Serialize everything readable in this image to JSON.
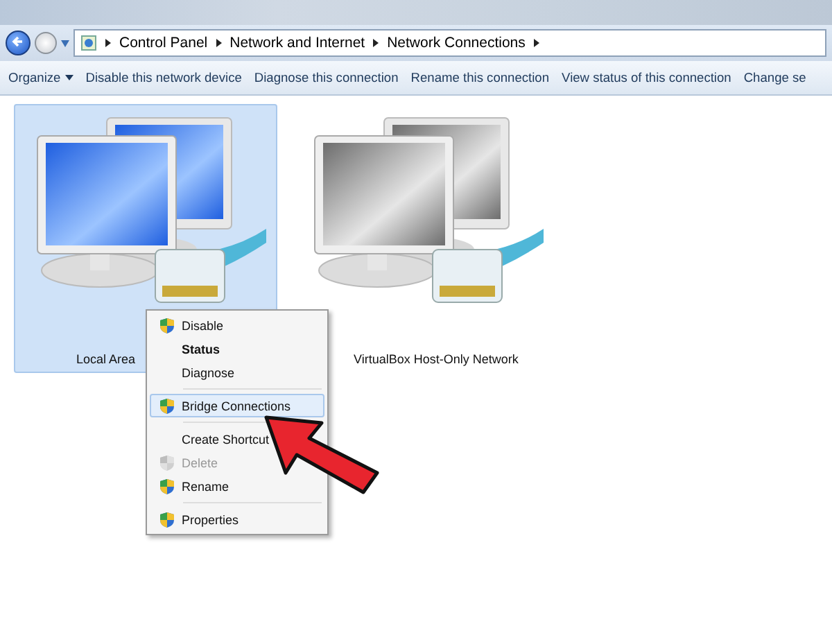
{
  "address_bar": {
    "crumbs": [
      "Control Panel",
      "Network and Internet",
      "Network Connections"
    ]
  },
  "toolbar": {
    "buttons": [
      {
        "label": "Organize",
        "dropdown": true
      },
      {
        "label": "Disable this network device",
        "dropdown": false
      },
      {
        "label": "Diagnose this connection",
        "dropdown": false
      },
      {
        "label": "Rename this connection",
        "dropdown": false
      },
      {
        "label": "View status of this connection",
        "dropdown": false
      },
      {
        "label": "Change se",
        "dropdown": false
      }
    ]
  },
  "connections": [
    {
      "name": "Local Area",
      "selected": true,
      "enabled": true
    },
    {
      "name": "VirtualBox Host-Only Network",
      "selected": false,
      "enabled": false
    }
  ],
  "context_menu": {
    "items": [
      {
        "kind": "item",
        "label": "Disable",
        "shield": true,
        "bold": false,
        "disabled": false,
        "selected": false
      },
      {
        "kind": "item",
        "label": "Status",
        "shield": false,
        "bold": true,
        "disabled": false,
        "selected": false
      },
      {
        "kind": "item",
        "label": "Diagnose",
        "shield": false,
        "bold": false,
        "disabled": false,
        "selected": false
      },
      {
        "kind": "separator"
      },
      {
        "kind": "item",
        "label": "Bridge Connections",
        "shield": true,
        "bold": false,
        "disabled": false,
        "selected": true
      },
      {
        "kind": "separator"
      },
      {
        "kind": "item",
        "label": "Create Shortcut",
        "shield": false,
        "bold": false,
        "disabled": false,
        "selected": false
      },
      {
        "kind": "item",
        "label": "Delete",
        "shield": true,
        "bold": false,
        "disabled": true,
        "selected": false
      },
      {
        "kind": "item",
        "label": "Rename",
        "shield": true,
        "bold": false,
        "disabled": false,
        "selected": false
      },
      {
        "kind": "separator"
      },
      {
        "kind": "item",
        "label": "Properties",
        "shield": true,
        "bold": false,
        "disabled": false,
        "selected": false
      }
    ]
  }
}
